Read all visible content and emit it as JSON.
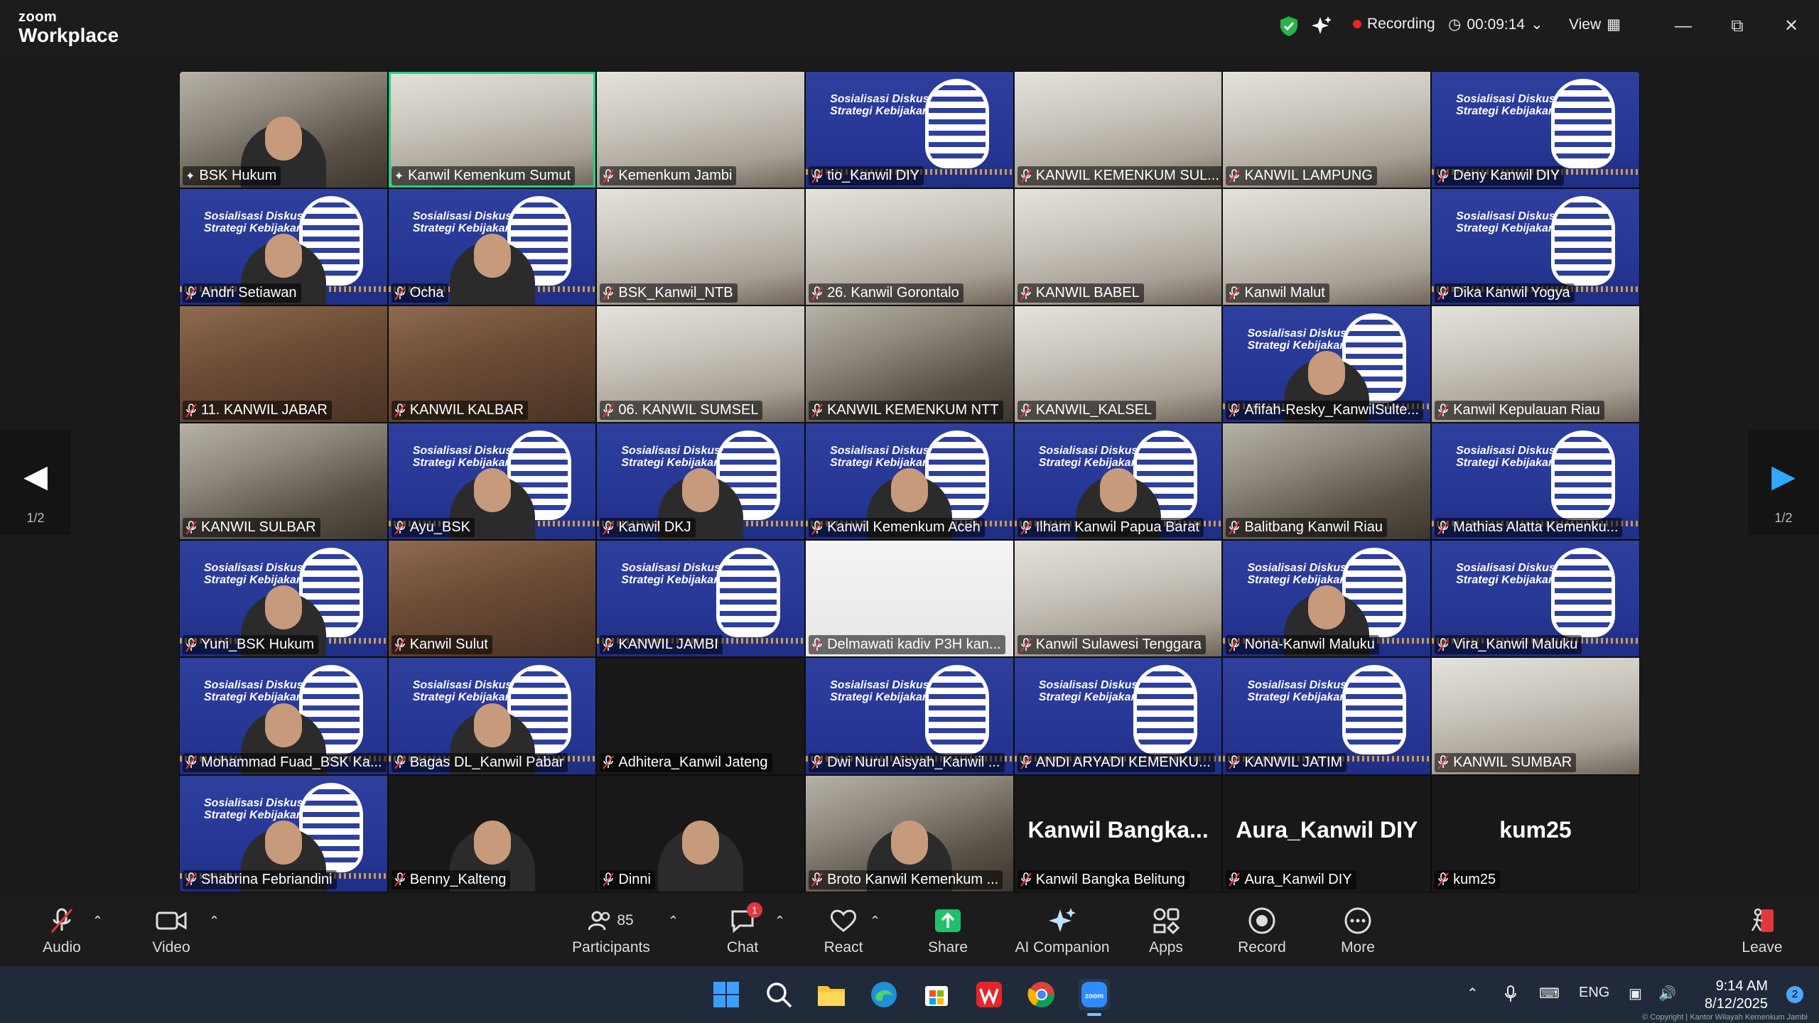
{
  "app": {
    "brand_top": "zoom",
    "brand_bottom": "Workplace"
  },
  "titlebar": {
    "recording_label": "Recording",
    "timer": "00:09:14",
    "view_label": "View"
  },
  "pager": {
    "left_page": "1/2",
    "right_page": "1/2"
  },
  "big_names": [
    "Kanwil  Bangka...",
    "Aura_Kanwil DIY",
    "kum25"
  ],
  "tiles": [
    "BSK Hukum",
    "Kanwil Kemenkum Sumut",
    "Kemenkum Jambi",
    "tio_Kanwil DIY",
    "KANWIL KEMENKUM SUL...",
    "KANWIL LAMPUNG",
    "Deny Kanwil DIY",
    "Andri Setiawan",
    "Ocha",
    "BSK_Kanwil_NTB",
    "26. Kanwil Gorontalo",
    "KANWIL BABEL",
    "Kanwil Malut",
    "Dika Kanwil Yogya",
    "11. KANWIL JABAR",
    "KANWIL KALBAR",
    "06. KANWIL SUMSEL",
    "KANWIL KEMENKUM NTT",
    "KANWIL_KALSEL",
    "Afifah-Resky_KanwilSulte...",
    "Kanwil Kepulauan Riau",
    "KANWIL SULBAR",
    "Ayu_BSK",
    "Kanwil DKJ",
    "Kanwil Kemenkum Aceh",
    "Ilham Kanwil Papua Barat",
    "Balitbang Kanwil Riau",
    "Mathias Alatta Kemenku...",
    "Yuni_BSK Hukum",
    "Kanwil Sulut",
    "KANWIL JAMBI",
    "Delmawati kadiv P3H kan...",
    "Kanwil Sulawesi Tenggara",
    "Nona-Kanwil Maluku",
    "Vira_Kanwil Maluku",
    "Mohammad Fuad_BSK Ka...",
    "Bagas DL_Kanwil Pabar",
    "Adhitera_Kanwil Jateng",
    "Dwi Nurul Aisyah_Kanwil ...",
    "ANDI ARYADI KEMENKU...",
    "KANWIL JATIM",
    "KANWIL SUMBAR",
    "Shabrina Febriandini",
    "Benny_Kalteng",
    "Dinni",
    "Broto Kanwil Kemenkum ...",
    "Kanwil Bangka Belitung",
    "Aura_Kanwil DIY",
    "kum25"
  ],
  "banner": {
    "line1": "Sosialisasi Diskusi",
    "line2": "Strategi Kebijakan"
  },
  "toolbar": {
    "audio": "Audio",
    "video": "Video",
    "participants": "Participants",
    "participants_count": "85",
    "chat": "Chat",
    "chat_badge": "1",
    "react": "React",
    "share": "Share",
    "ai": "AI Companion",
    "apps": "Apps",
    "record": "Record",
    "more": "More",
    "leave": "Leave"
  },
  "taskbar": {
    "lang": "ENG",
    "time": "9:14 AM",
    "date": "8/12/2025",
    "notifications": "2",
    "copyright": "© Copyright | Kantor Wilayah Kemenkum Jambi"
  },
  "colors": {
    "speaking_border": "#22d37f",
    "banner_blue": "#2e3f9d",
    "record_red": "#e8262a"
  }
}
